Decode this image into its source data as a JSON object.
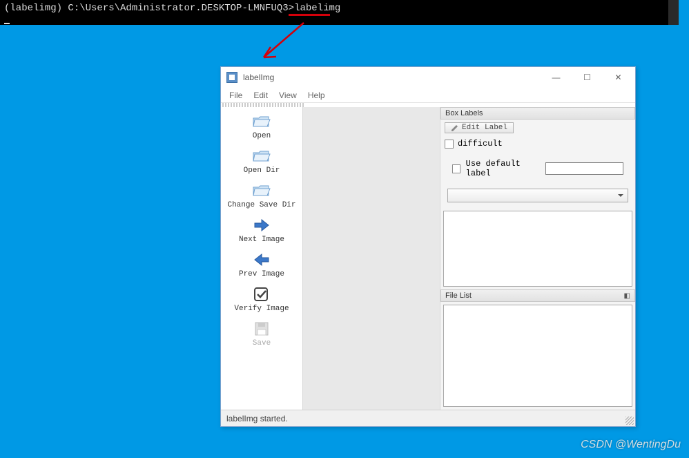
{
  "terminal": {
    "prompt": "(labelimg) C:\\Users\\Administrator.DESKTOP-LMNFUQ3>",
    "command": "labelimg"
  },
  "window": {
    "title": "labelImg",
    "controls": {
      "min": "—",
      "max": "☐",
      "close": "✕"
    }
  },
  "menu": {
    "file": "File",
    "edit": "Edit",
    "view": "View",
    "help": "Help"
  },
  "toolbar": {
    "open": "Open",
    "open_dir": "Open Dir",
    "change_save_dir": "Change Save Dir",
    "next_image": "Next Image",
    "prev_image": "Prev Image",
    "verify_image": "Verify Image",
    "save": "Save"
  },
  "panels": {
    "box_labels": {
      "title": "Box Labels",
      "edit_label": "Edit Label",
      "difficult": "difficult",
      "use_default_label": "Use default label"
    },
    "file_list": {
      "title": "File List"
    }
  },
  "statusbar": {
    "text": "labelImg started."
  },
  "watermark": "CSDN @WentingDu"
}
